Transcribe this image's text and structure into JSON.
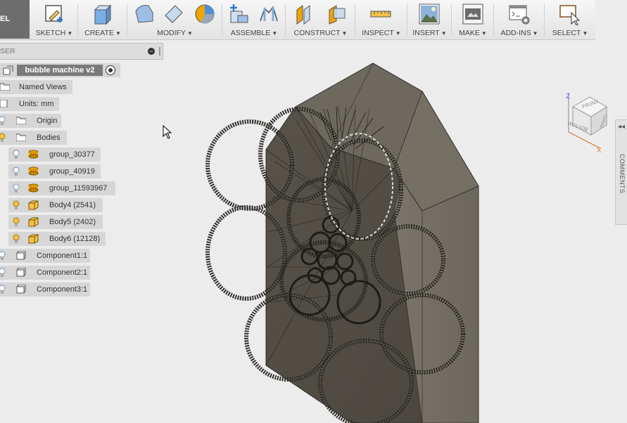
{
  "toolbar": {
    "workspace_label": "EL",
    "groups": [
      {
        "label": "SKETCH"
      },
      {
        "label": "CREATE"
      },
      {
        "label": "MODIFY"
      },
      {
        "label": "ASSEMBLE"
      },
      {
        "label": "CONSTRUCT"
      },
      {
        "label": "INSPECT"
      },
      {
        "label": "INSERT"
      },
      {
        "label": "MAKE"
      },
      {
        "label": "ADD-INS"
      },
      {
        "label": "SELECT"
      }
    ],
    "caret": "▼"
  },
  "browser": {
    "header_title": "SER",
    "collapse_glyph": "−",
    "root": {
      "name": "bubble machine v2"
    },
    "items": [
      {
        "label": "Named Views",
        "icon": "folder-icon"
      },
      {
        "label": "Units: mm",
        "icon": "units-icon"
      },
      {
        "label": "Origin",
        "icon": "folder-icon"
      },
      {
        "label": "Bodies",
        "icon": "folder-icon"
      },
      {
        "label": "group_30377",
        "icon": "mesh-body-icon"
      },
      {
        "label": "group_40919",
        "icon": "mesh-body-icon"
      },
      {
        "label": "group_11593967",
        "icon": "mesh-body-icon"
      },
      {
        "label": "Body4 (2541)",
        "icon": "solid-body-icon"
      },
      {
        "label": "Body5 (2402)",
        "icon": "solid-body-icon"
      },
      {
        "label": "Body6 (12128)",
        "icon": "solid-body-icon"
      },
      {
        "label": "Component1:1",
        "icon": "component-icon"
      },
      {
        "label": "Component2:1",
        "icon": "component-icon"
      },
      {
        "label": "Component3:1",
        "icon": "component-icon"
      }
    ]
  },
  "viewcube": {
    "top": "FRONT",
    "left": "BOTTOM",
    "right": "RIGHT",
    "axis_z": "Z",
    "axis_x": "X"
  },
  "comments": {
    "label": "COMMENTS",
    "arrows": "◂◂"
  },
  "colors": {
    "accent": "#f0a500",
    "toolbar": "#e9e9e9",
    "model": "#6b665c"
  }
}
